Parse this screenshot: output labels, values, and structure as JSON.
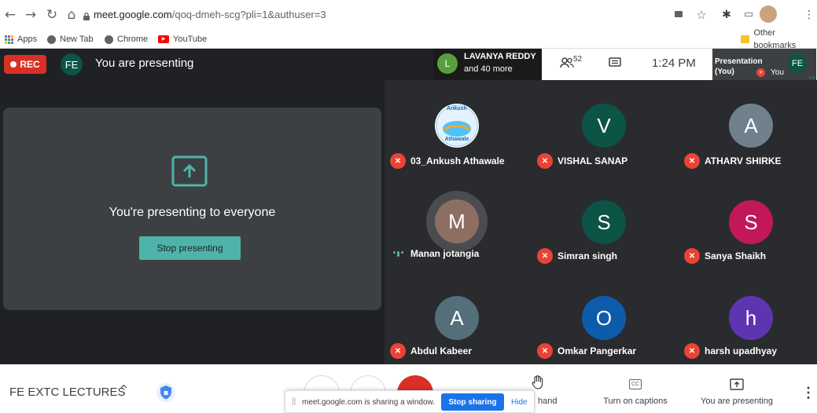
{
  "browser": {
    "url_host": "meet.google.com",
    "url_path": "/qoq-dmeh-scg?pli=1&authuser=3",
    "bookmarks": [
      "Apps",
      "New Tab",
      "Chrome",
      "YouTube"
    ],
    "other_bookmarks": "Other bookmarks"
  },
  "topbar": {
    "rec_label": "REC",
    "presenter_initials": "FE",
    "presenting_label": "You are presenting",
    "participant_name": "LAVANYA REDDY",
    "participant_more": "and 40 more",
    "participant_initial": "L",
    "people_count": "52",
    "time": "1:24 PM",
    "presentation_label": "Presentation",
    "presentation_sub": "(You)",
    "you_label": "You",
    "you_initials": "FE"
  },
  "presentation": {
    "message": "You're presenting to everyone",
    "stop_button": "Stop presenting"
  },
  "tiles": [
    {
      "name": "03_Ankush Athawale",
      "initial": "",
      "logo_top": "Ankush",
      "logo_bottom": "Athawale",
      "color": "#ffffff",
      "muted": true
    },
    {
      "name": "VISHAL SANAP",
      "initial": "V",
      "color": "#0b5446",
      "muted": true
    },
    {
      "name": "ATHARV SHIRKE",
      "initial": "A",
      "color": "#6e818d",
      "muted": true
    },
    {
      "name": "Manan jotangia",
      "initial": "M",
      "color": "#8d6e63",
      "muted": false
    },
    {
      "name": "Simran singh",
      "initial": "S",
      "color": "#0b5446",
      "muted": true
    },
    {
      "name": "Sanya Shaikh",
      "initial": "S",
      "color": "#c2185b",
      "muted": true
    },
    {
      "name": "Abdul Kabeer",
      "initial": "A",
      "color": "#546e7a",
      "muted": true
    },
    {
      "name": "Omkar Pangerkar",
      "initial": "O",
      "color": "#0d5cab",
      "muted": true
    },
    {
      "name": "harsh upadhyay",
      "initial": "h",
      "color": "#5e35b1",
      "muted": true
    }
  ],
  "bottombar": {
    "meeting_title": "FE EXTC LECTURES",
    "raise_hand": "hand",
    "captions": "Turn on captions",
    "presenting": "You are presenting"
  },
  "share_popup": {
    "message": "meet.google.com is sharing a window.",
    "stop_sharing": "Stop sharing",
    "hide": "Hide"
  }
}
